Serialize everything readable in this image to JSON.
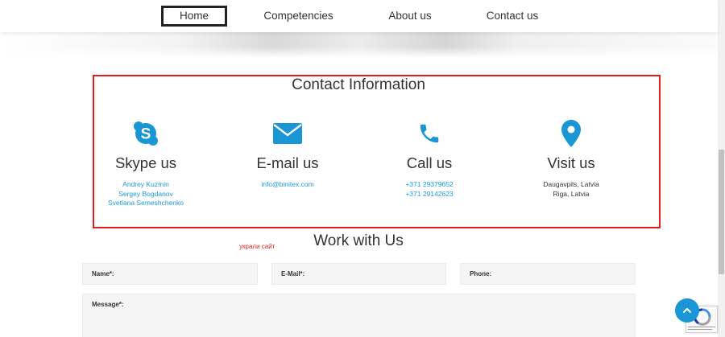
{
  "nav": {
    "items": [
      {
        "label": "Home",
        "active": true
      },
      {
        "label": "Competencies"
      },
      {
        "label": "About us"
      },
      {
        "label": "Contact us"
      }
    ]
  },
  "contact": {
    "title": "Contact Information",
    "columns": [
      {
        "icon": "skype-icon",
        "heading": "Skype us",
        "lines": [
          "Andrey Kuzmin",
          "Sergey Bogdanov",
          "Svetlana Semeshchenko"
        ],
        "link": true
      },
      {
        "icon": "envelope-icon",
        "heading": "E-mail us",
        "lines": [
          "info@binitex.com"
        ],
        "link": true
      },
      {
        "icon": "phone-icon",
        "heading": "Call us",
        "lines": [
          "+371 29379652",
          "+371 29142623"
        ],
        "link": true
      },
      {
        "icon": "map-pin-icon",
        "heading": "Visit us",
        "lines": [
          "Daugavpils, Latvia",
          "Riga, Latvia"
        ],
        "link": false
      }
    ]
  },
  "annotation": {
    "text": "украли сайт",
    "color": "#e01c1c"
  },
  "work": {
    "title": "Work with Us",
    "fields": {
      "name": "Name*:",
      "email": "E-Mail*:",
      "phone": "Phone:",
      "message": "Message*:"
    }
  },
  "colors": {
    "accent": "#1a96d4",
    "link": "#1a9ad6",
    "highlight": "#e01c1c"
  }
}
